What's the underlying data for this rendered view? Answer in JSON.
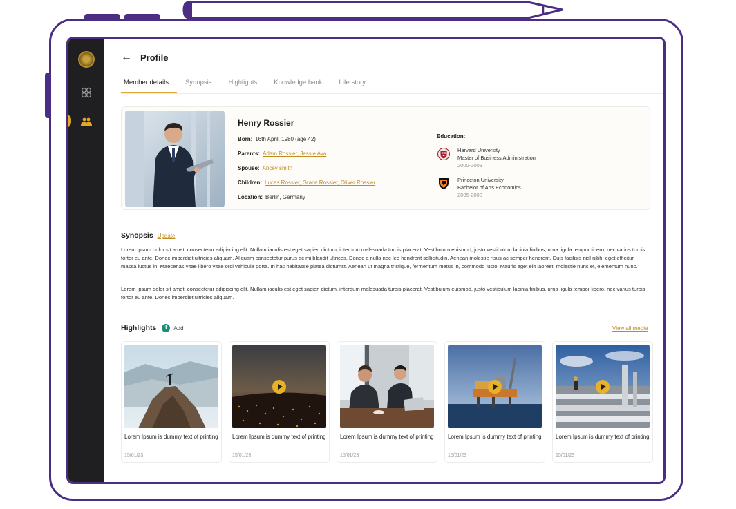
{
  "header": {
    "back_icon": "arrow-left-icon",
    "title": "Profile"
  },
  "tabs": [
    {
      "label": "Member details",
      "active": true
    },
    {
      "label": "Synopsis"
    },
    {
      "label": "Highlights"
    },
    {
      "label": "Knowledge bank"
    },
    {
      "label": "Life story"
    }
  ],
  "sidebar": {
    "items": [
      "logo",
      "grid-icon",
      "members-icon"
    ]
  },
  "profile": {
    "name": "Henry Rossier",
    "born_label": "Born:",
    "born": "16th April, 1980 (age 42)",
    "parents_label": "Parents:",
    "parents": "Adam Rossier, Jessie Ava",
    "spouse_label": "Spouse:",
    "spouse": "Ancey smith",
    "children_label": "Children:",
    "children": "Lucas Rossier, Grace Rossier, Oliver Rossier",
    "location_label": "Location:",
    "location": "Berlin, Germany",
    "education_title": "Education:",
    "education": [
      {
        "school": "Harvard University",
        "degree": "Master of Business Administration",
        "years": "2000-2003",
        "icon": "harvard-crest-icon"
      },
      {
        "school": "Princeton University",
        "degree": "Bachelor of Arts Economics",
        "years": "2005-2008",
        "icon": "princeton-shield-icon"
      }
    ]
  },
  "synopsis": {
    "title": "Synopsis",
    "update_label": "Update",
    "paragraphs": [
      "Lorem ipsum dolor sit amet, consectetur adipiscing elit. Nullam iaculis est eget sapien dictum, interdum malesuada turpis placerat. Vestibulum euismod, justo vestibulum lacinia finibus, urna ligula tempor libero, nec varius turpis tortor eu ante. Donec imperdiet ultricies aliquam. Aliquam consectetur purus ac mi blandit ultrices. Donec a nulla nec leo hendrerit sollicitudin. Aenean molestie risus ac semper hendrerit. Duis facilisis nisl nibh, eget efficitur massa luctus in. Maecenas vitae libero vitae orci vehicula porta. In hac habitasse platea dictumst. Aenean ut magna tristique, fermentum metus in, commodo justo. Mauris eget elit laoreet, molestie nunc et, elementum nunc.",
      "Lorem ipsum dolor sit amet, consectetur adipiscing elit. Nullam iaculis est eget sapien dictum, interdum malesuada turpis placerat. Vestibulum euismod, justo vestibulum lacinia finibus, urna ligula tempor libero, nec varius turpis tortor eu ante. Donec imperdiet ultricies aliquam."
    ]
  },
  "highlights": {
    "title": "Highlights",
    "add_label": "Add",
    "view_all_label": "View all media",
    "items": [
      {
        "title": "Lorem Ipsum is dummy text of printing",
        "date": "15/01/23",
        "video": false
      },
      {
        "title": "Lorem Ipsum is dummy text of printing",
        "date": "15/01/23",
        "video": true
      },
      {
        "title": "Lorem Ipsum is dummy text of printing",
        "date": "15/01/23",
        "video": false
      },
      {
        "title": "Lorem Ipsum is dummy text of printing",
        "date": "15/01/23",
        "video": true
      },
      {
        "title": "Lorem Ipsum is dummy text of printing",
        "date": "15/01/23",
        "video": true
      }
    ]
  },
  "colors": {
    "frame": "#4b2e83",
    "accent": "#e0a82e",
    "link": "#c08b22",
    "sidebar": "#1f1f22",
    "add_green": "#1a8d74"
  }
}
